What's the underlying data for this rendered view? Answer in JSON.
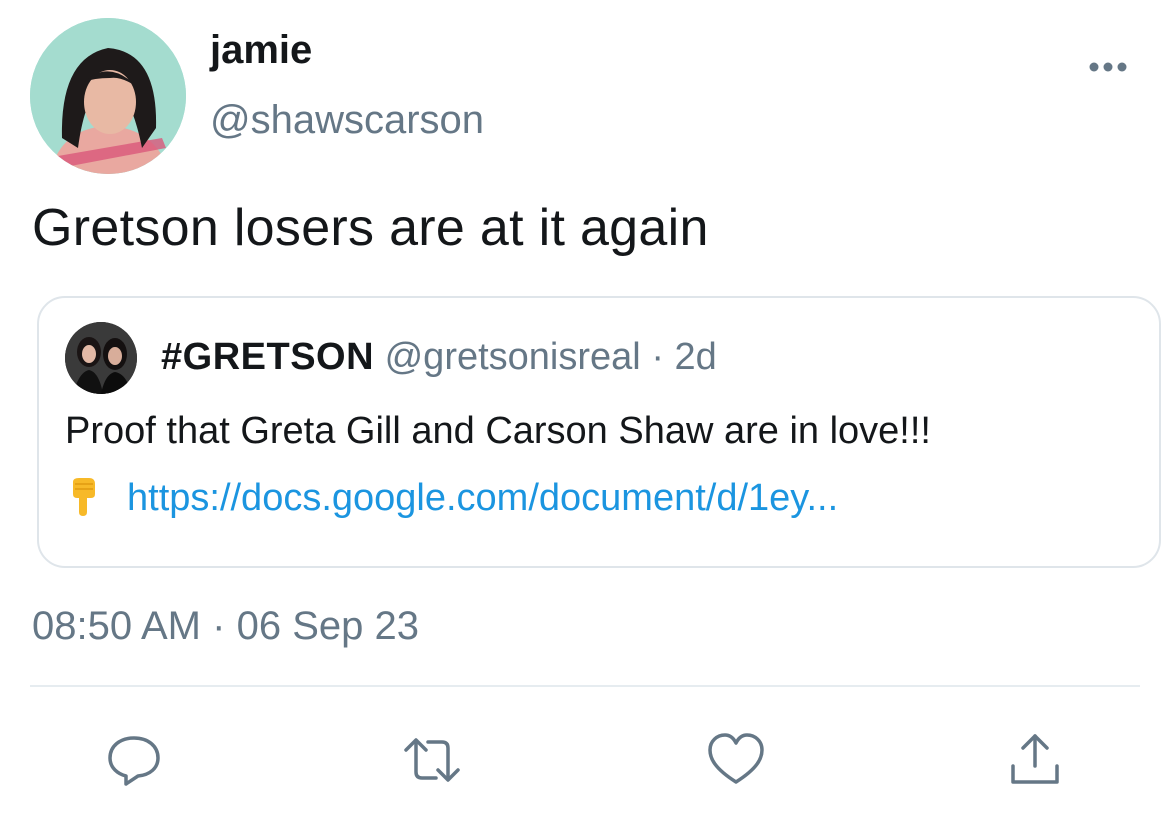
{
  "tweet": {
    "author": {
      "display_name": "jamie",
      "handle": "@shawscarson"
    },
    "text": "Gretson losers are at it again",
    "timestamp": {
      "time": "08:50 AM",
      "separator": "·",
      "date": "06 Sep 23"
    }
  },
  "quoted_tweet": {
    "author_name": "#GRETSON",
    "handle": "@gretsonisreal",
    "separator": "·",
    "age": "2d",
    "text": "Proof that Greta Gill and Carson Shaw are in love!!!",
    "emoji": "pointing-down-emoji",
    "link": "https://docs.google.com/document/d/1ey..."
  },
  "icons": {
    "more": "more-horizontal-icon",
    "reply": "reply-icon",
    "retweet": "retweet-icon",
    "like": "heart-icon",
    "share": "share-icon"
  },
  "colors": {
    "text": "#14171a",
    "muted": "#657786",
    "link": "#1b95e0",
    "border": "#dfe5ea"
  }
}
